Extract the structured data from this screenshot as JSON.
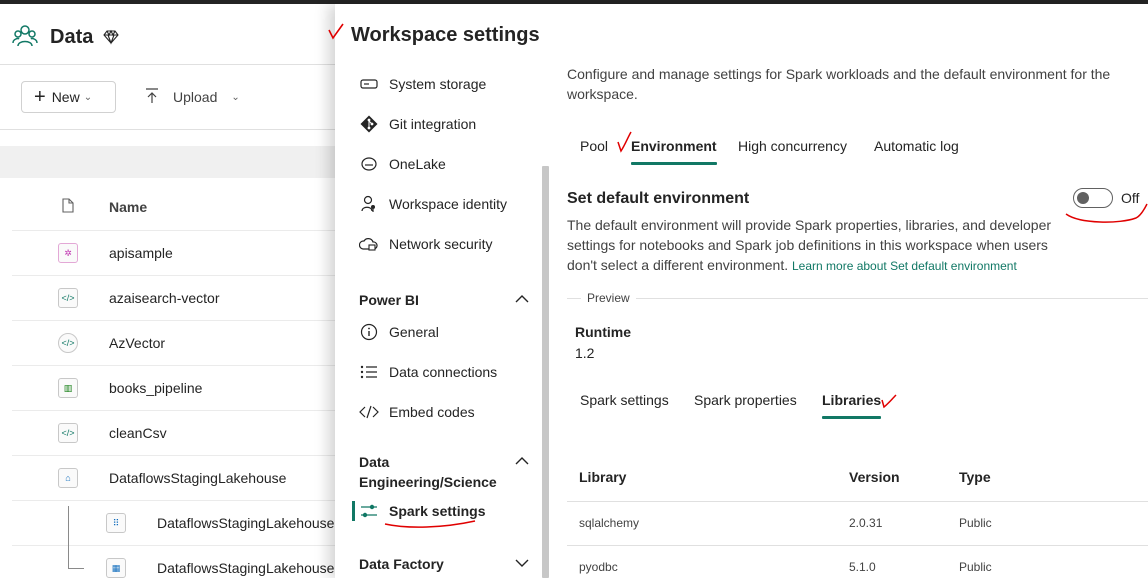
{
  "workspace": {
    "title": "Data"
  },
  "toolbar": {
    "new_label": "New",
    "upload_label": "Upload"
  },
  "list": {
    "header_name": "Name",
    "items": [
      {
        "label": "apisample",
        "icon": "notebook-icon"
      },
      {
        "label": "azaisearch-vector",
        "icon": "notebook-icon"
      },
      {
        "label": "AzVector",
        "icon": "notebook-icon"
      },
      {
        "label": "books_pipeline",
        "icon": "pipeline-icon"
      },
      {
        "label": "cleanCsv",
        "icon": "notebook-icon"
      },
      {
        "label": "DataflowsStagingLakehouse",
        "icon": "lakehouse-icon"
      },
      {
        "label": "DataflowsStagingLakehouse",
        "icon": "sql-endpoint-icon"
      },
      {
        "label": "DataflowsStagingLakehouse",
        "icon": "semantic-model-icon"
      }
    ]
  },
  "panel": {
    "title": "Workspace settings",
    "nav": {
      "items": [
        {
          "label": "System storage",
          "icon": "storage-icon"
        },
        {
          "label": "Git integration",
          "icon": "git-icon"
        },
        {
          "label": "OneLake",
          "icon": "onelake-icon"
        },
        {
          "label": "Workspace identity",
          "icon": "identity-icon"
        },
        {
          "label": "Network security",
          "icon": "cloud-lock-icon"
        }
      ],
      "power_bi": {
        "title": "Power BI",
        "items": [
          {
            "label": "General",
            "icon": "info-icon"
          },
          {
            "label": "Data connections",
            "icon": "list-icon"
          },
          {
            "label": "Embed codes",
            "icon": "code-icon"
          }
        ]
      },
      "data_engineering": {
        "title": "Data Engineering/Science",
        "items": [
          {
            "label": "Spark settings",
            "icon": "sliders-icon"
          }
        ]
      },
      "data_factory": {
        "title": "Data Factory"
      }
    },
    "description": "Configure and manage settings for Spark workloads and the default environment for the workspace.",
    "tabs": [
      "Pool",
      "Environment",
      "High concurrency",
      "Automatic log"
    ],
    "active_tab": "Environment",
    "default_env": {
      "title": "Set default environment",
      "toggle_label": "Off",
      "toggle_on": false,
      "description": "The default environment will provide Spark properties, libraries, and developer settings for notebooks and Spark job definitions in this workspace when users don't select a different environment.",
      "link": "Learn more about Set default environment"
    },
    "preview_label": "Preview",
    "runtime": {
      "label": "Runtime",
      "value": "1.2"
    },
    "subtabs": [
      "Spark settings",
      "Spark properties",
      "Libraries"
    ],
    "active_subtab": "Libraries",
    "libraries": {
      "columns": [
        "Library",
        "Version",
        "Type"
      ],
      "rows": [
        [
          "sqlalchemy",
          "2.0.31",
          "Public"
        ],
        [
          "pyodbc",
          "5.1.0",
          "Public"
        ]
      ]
    }
  },
  "colors": {
    "accent": "#117865",
    "annotation": "#e00000"
  }
}
